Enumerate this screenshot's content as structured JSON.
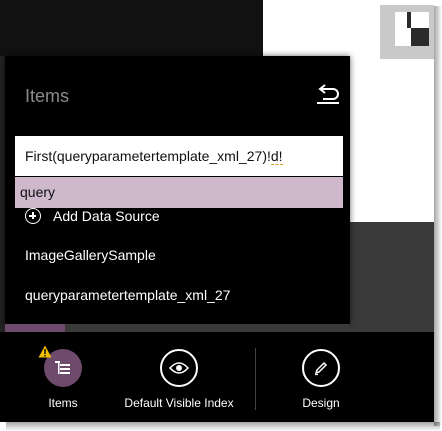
{
  "panel": {
    "title": "Items",
    "formula": {
      "prefix": "First(queryparametertemplate_xml_27)!",
      "squiggle": "d!"
    },
    "suggestion": "query",
    "add_source_label": "Add Data Source",
    "sources": [
      "ImageGallerySample",
      "queryparametertemplate_xml_27"
    ]
  },
  "toolbar": {
    "items_label": "Items",
    "default_visible_index_label": "Default Visible Index",
    "design_label": "Design"
  },
  "colors": {
    "accent": "#6e4a6c",
    "suggestion_bg": "#cdb8cc",
    "warning": "#f0c000"
  }
}
